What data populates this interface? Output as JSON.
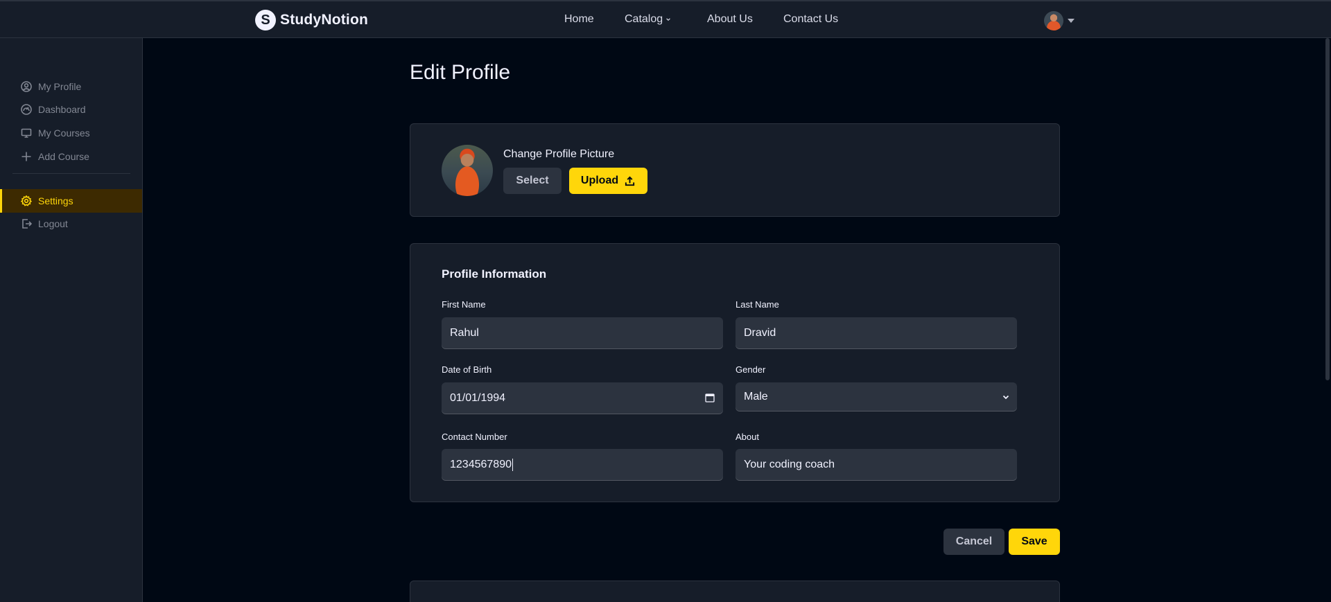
{
  "brand": {
    "name": "StudyNotion",
    "mark": "S"
  },
  "nav": {
    "home": "Home",
    "catalog": "Catalog",
    "about": "About Us",
    "contact": "Contact Us"
  },
  "sidebar": {
    "items": [
      {
        "label": "My Profile",
        "icon": "user-circle-icon"
      },
      {
        "label": "Dashboard",
        "icon": "gauge-icon"
      },
      {
        "label": "My Courses",
        "icon": "monitor-icon"
      },
      {
        "label": "Add Course",
        "icon": "plus-icon"
      }
    ],
    "settings": {
      "label": "Settings",
      "icon": "gear-icon",
      "active": true
    },
    "logout": {
      "label": "Logout",
      "icon": "logout-icon"
    }
  },
  "page": {
    "title": "Edit Profile"
  },
  "picture": {
    "label": "Change Profile Picture",
    "select_label": "Select",
    "upload_label": "Upload"
  },
  "profile_info": {
    "title": "Profile Information",
    "first_name": {
      "label": "First Name",
      "value": "Rahul"
    },
    "last_name": {
      "label": "Last Name",
      "value": "Dravid"
    },
    "dob": {
      "label": "Date of Birth",
      "value": "01/01/1994"
    },
    "gender": {
      "label": "Gender",
      "value": "Male"
    },
    "contact": {
      "label": "Contact Number",
      "value": "1234567890"
    },
    "about": {
      "label": "About",
      "value": "Your coding coach"
    }
  },
  "actions": {
    "cancel_label": "Cancel",
    "save_label": "Save"
  },
  "colors": {
    "background": "#000814",
    "surface": "#161D29",
    "field": "#2C333F",
    "accent": "#FFD60A",
    "active_bg": "#3D2A01"
  }
}
